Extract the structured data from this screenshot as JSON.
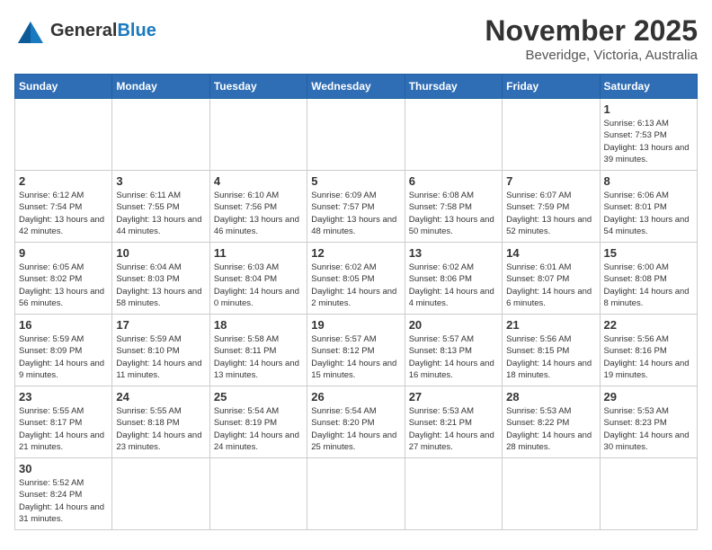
{
  "header": {
    "logo_general": "General",
    "logo_blue": "Blue",
    "title": "November 2025",
    "subtitle": "Beveridge, Victoria, Australia"
  },
  "weekdays": [
    "Sunday",
    "Monday",
    "Tuesday",
    "Wednesday",
    "Thursday",
    "Friday",
    "Saturday"
  ],
  "weeks": [
    [
      {
        "day": "",
        "info": ""
      },
      {
        "day": "",
        "info": ""
      },
      {
        "day": "",
        "info": ""
      },
      {
        "day": "",
        "info": ""
      },
      {
        "day": "",
        "info": ""
      },
      {
        "day": "",
        "info": ""
      },
      {
        "day": "1",
        "info": "Sunrise: 6:13 AM\nSunset: 7:53 PM\nDaylight: 13 hours and 39 minutes."
      }
    ],
    [
      {
        "day": "2",
        "info": "Sunrise: 6:12 AM\nSunset: 7:54 PM\nDaylight: 13 hours and 42 minutes."
      },
      {
        "day": "3",
        "info": "Sunrise: 6:11 AM\nSunset: 7:55 PM\nDaylight: 13 hours and 44 minutes."
      },
      {
        "day": "4",
        "info": "Sunrise: 6:10 AM\nSunset: 7:56 PM\nDaylight: 13 hours and 46 minutes."
      },
      {
        "day": "5",
        "info": "Sunrise: 6:09 AM\nSunset: 7:57 PM\nDaylight: 13 hours and 48 minutes."
      },
      {
        "day": "6",
        "info": "Sunrise: 6:08 AM\nSunset: 7:58 PM\nDaylight: 13 hours and 50 minutes."
      },
      {
        "day": "7",
        "info": "Sunrise: 6:07 AM\nSunset: 7:59 PM\nDaylight: 13 hours and 52 minutes."
      },
      {
        "day": "8",
        "info": "Sunrise: 6:06 AM\nSunset: 8:01 PM\nDaylight: 13 hours and 54 minutes."
      }
    ],
    [
      {
        "day": "9",
        "info": "Sunrise: 6:05 AM\nSunset: 8:02 PM\nDaylight: 13 hours and 56 minutes."
      },
      {
        "day": "10",
        "info": "Sunrise: 6:04 AM\nSunset: 8:03 PM\nDaylight: 13 hours and 58 minutes."
      },
      {
        "day": "11",
        "info": "Sunrise: 6:03 AM\nSunset: 8:04 PM\nDaylight: 14 hours and 0 minutes."
      },
      {
        "day": "12",
        "info": "Sunrise: 6:02 AM\nSunset: 8:05 PM\nDaylight: 14 hours and 2 minutes."
      },
      {
        "day": "13",
        "info": "Sunrise: 6:02 AM\nSunset: 8:06 PM\nDaylight: 14 hours and 4 minutes."
      },
      {
        "day": "14",
        "info": "Sunrise: 6:01 AM\nSunset: 8:07 PM\nDaylight: 14 hours and 6 minutes."
      },
      {
        "day": "15",
        "info": "Sunrise: 6:00 AM\nSunset: 8:08 PM\nDaylight: 14 hours and 8 minutes."
      }
    ],
    [
      {
        "day": "16",
        "info": "Sunrise: 5:59 AM\nSunset: 8:09 PM\nDaylight: 14 hours and 9 minutes."
      },
      {
        "day": "17",
        "info": "Sunrise: 5:59 AM\nSunset: 8:10 PM\nDaylight: 14 hours and 11 minutes."
      },
      {
        "day": "18",
        "info": "Sunrise: 5:58 AM\nSunset: 8:11 PM\nDaylight: 14 hours and 13 minutes."
      },
      {
        "day": "19",
        "info": "Sunrise: 5:57 AM\nSunset: 8:12 PM\nDaylight: 14 hours and 15 minutes."
      },
      {
        "day": "20",
        "info": "Sunrise: 5:57 AM\nSunset: 8:13 PM\nDaylight: 14 hours and 16 minutes."
      },
      {
        "day": "21",
        "info": "Sunrise: 5:56 AM\nSunset: 8:15 PM\nDaylight: 14 hours and 18 minutes."
      },
      {
        "day": "22",
        "info": "Sunrise: 5:56 AM\nSunset: 8:16 PM\nDaylight: 14 hours and 19 minutes."
      }
    ],
    [
      {
        "day": "23",
        "info": "Sunrise: 5:55 AM\nSunset: 8:17 PM\nDaylight: 14 hours and 21 minutes."
      },
      {
        "day": "24",
        "info": "Sunrise: 5:55 AM\nSunset: 8:18 PM\nDaylight: 14 hours and 23 minutes."
      },
      {
        "day": "25",
        "info": "Sunrise: 5:54 AM\nSunset: 8:19 PM\nDaylight: 14 hours and 24 minutes."
      },
      {
        "day": "26",
        "info": "Sunrise: 5:54 AM\nSunset: 8:20 PM\nDaylight: 14 hours and 25 minutes."
      },
      {
        "day": "27",
        "info": "Sunrise: 5:53 AM\nSunset: 8:21 PM\nDaylight: 14 hours and 27 minutes."
      },
      {
        "day": "28",
        "info": "Sunrise: 5:53 AM\nSunset: 8:22 PM\nDaylight: 14 hours and 28 minutes."
      },
      {
        "day": "29",
        "info": "Sunrise: 5:53 AM\nSunset: 8:23 PM\nDaylight: 14 hours and 30 minutes."
      }
    ],
    [
      {
        "day": "30",
        "info": "Sunrise: 5:52 AM\nSunset: 8:24 PM\nDaylight: 14 hours and 31 minutes."
      },
      {
        "day": "",
        "info": ""
      },
      {
        "day": "",
        "info": ""
      },
      {
        "day": "",
        "info": ""
      },
      {
        "day": "",
        "info": ""
      },
      {
        "day": "",
        "info": ""
      },
      {
        "day": "",
        "info": ""
      }
    ]
  ]
}
